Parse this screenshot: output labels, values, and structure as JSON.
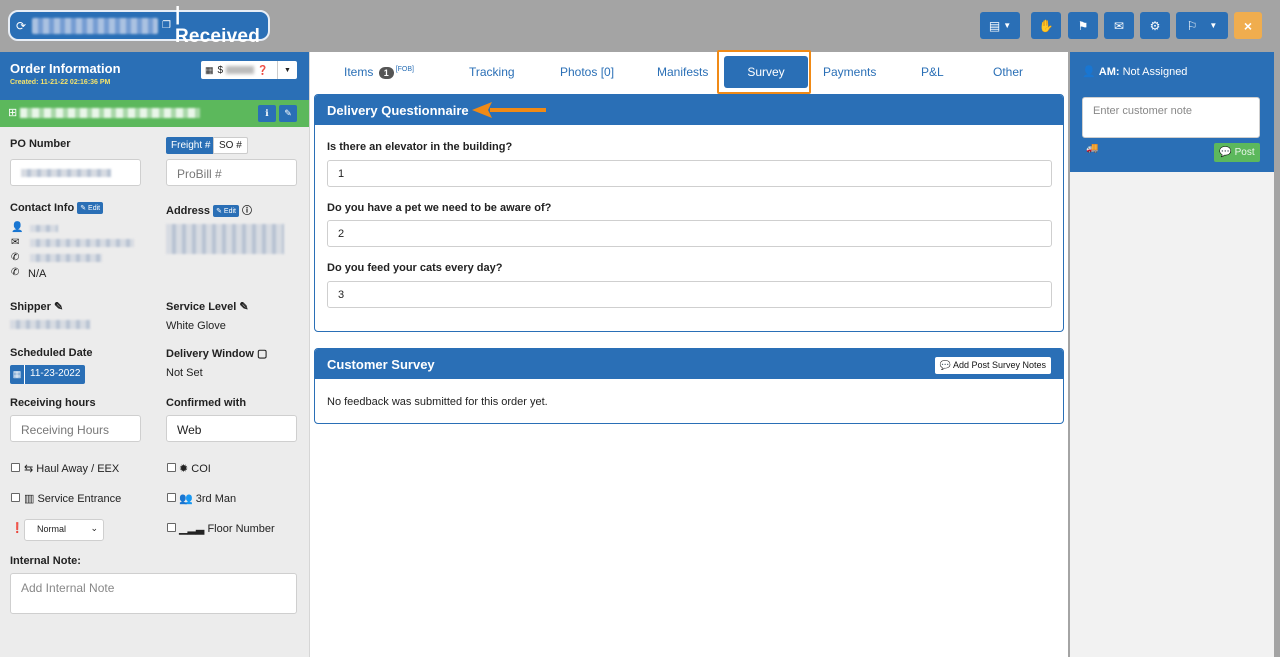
{
  "header": {
    "title": "| Received",
    "refresh_icon": "refresh-icon",
    "toolbar": {
      "doc_icon": "document-icon",
      "hand_icon": "hand-icon",
      "flag_icon": "flag-icon",
      "mail_icon": "envelope-icon",
      "gear_icon": "gear-icon",
      "flag_check_icon": "flag-check-icon",
      "close_label": "×"
    }
  },
  "order": {
    "title": "Order Information",
    "created": "Created: 11-21-22 02:16:36 PM",
    "price_prefix": "$",
    "po_label": "PO Number",
    "freight_tab": "Freight #",
    "so_tab": "SO #",
    "probill_placeholder": "ProBill #",
    "contact_label": "Contact Info",
    "edit_label": "Edit",
    "address_label": "Address",
    "phone_na": "N/A",
    "shipper_label": "Shipper",
    "service_level_label": "Service Level",
    "service_level_value": "White Glove",
    "scheduled_date_label": "Scheduled Date",
    "scheduled_date_value": "11-23-2022",
    "delivery_window_label": "Delivery Window",
    "delivery_window_value": "Not Set",
    "receiving_hours_label": "Receiving hours",
    "receiving_hours_placeholder": "Receiving Hours",
    "confirmed_with_label": "Confirmed with",
    "confirmed_with_value": "Web",
    "haul_away_label": "Haul Away / EEX",
    "coi_label": "COI",
    "service_entrance_label": "Service Entrance",
    "third_man_label": "3rd Man",
    "priority_value": "Normal",
    "floor_number_label": "Floor Number",
    "internal_note_label": "Internal Note:",
    "internal_note_placeholder": "Add Internal Note"
  },
  "tabs": {
    "items": "Items",
    "items_count": "1",
    "items_sup": "[FOB]",
    "tracking": "Tracking",
    "photos": "Photos [0]",
    "manifests": "Manifests",
    "survey": "Survey",
    "payments": "Payments",
    "pl": "P&L",
    "other": "Other"
  },
  "questionnaire": {
    "title": "Delivery Questionnaire",
    "questions": [
      {
        "question": "Is there an elevator in the building?",
        "answer": "1"
      },
      {
        "question": "Do you have a pet we need to be aware of?",
        "answer": "2"
      },
      {
        "question": "Do you feed your cats every day?",
        "answer": "3"
      }
    ]
  },
  "customer_survey": {
    "title": "Customer Survey",
    "add_notes_label": "Add Post Survey Notes",
    "empty_text": "No feedback was submitted for this order yet."
  },
  "right_panel": {
    "am_label": "AM:",
    "am_value": "Not Assigned",
    "note_placeholder": "Enter customer note",
    "post_label": "Post"
  },
  "colors": {
    "primary": "#2a6fb6",
    "success": "#5cb85c",
    "warning": "#f0ad4e",
    "highlight": "#f08a16"
  }
}
